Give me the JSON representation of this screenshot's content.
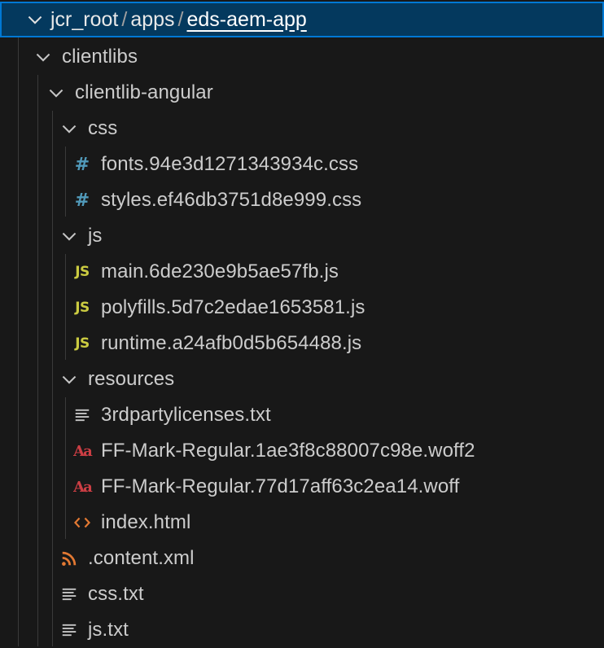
{
  "breadcrumb": {
    "items": [
      "jcr_root",
      "apps",
      "eds-aem-app"
    ],
    "separator": "/"
  },
  "tree": {
    "clientlibs": {
      "label": "clientlibs",
      "clientlib_angular": {
        "label": "clientlib-angular",
        "css": {
          "label": "css",
          "files": [
            "fonts.94e3d1271343934c.css",
            "styles.ef46db3751d8e999.css"
          ]
        },
        "js": {
          "label": "js",
          "files": [
            "main.6de230e9b5ae57fb.js",
            "polyfills.5d7c2edae1653581.js",
            "runtime.a24afb0d5b654488.js"
          ]
        },
        "resources": {
          "label": "resources",
          "files": [
            "3rdpartylicenses.txt",
            "FF-Mark-Regular.1ae3f8c88007c98e.woff2",
            "FF-Mark-Regular.77d17aff63c2ea14.woff",
            "index.html"
          ]
        },
        "content_xml": ".content.xml",
        "css_txt": "css.txt",
        "js_txt": "js.txt"
      }
    }
  },
  "icon_glyphs": {
    "css": "#",
    "js": "JS",
    "font": "Aa"
  },
  "colors": {
    "selection_bg": "#04395e",
    "selection_border": "#0078d4",
    "css_icon": "#519aba",
    "js_icon": "#cbcb41",
    "font_icon": "#cc3e44",
    "html_icon": "#e37933",
    "xml_icon": "#e37933",
    "text_icon": "#c5c5c5"
  }
}
